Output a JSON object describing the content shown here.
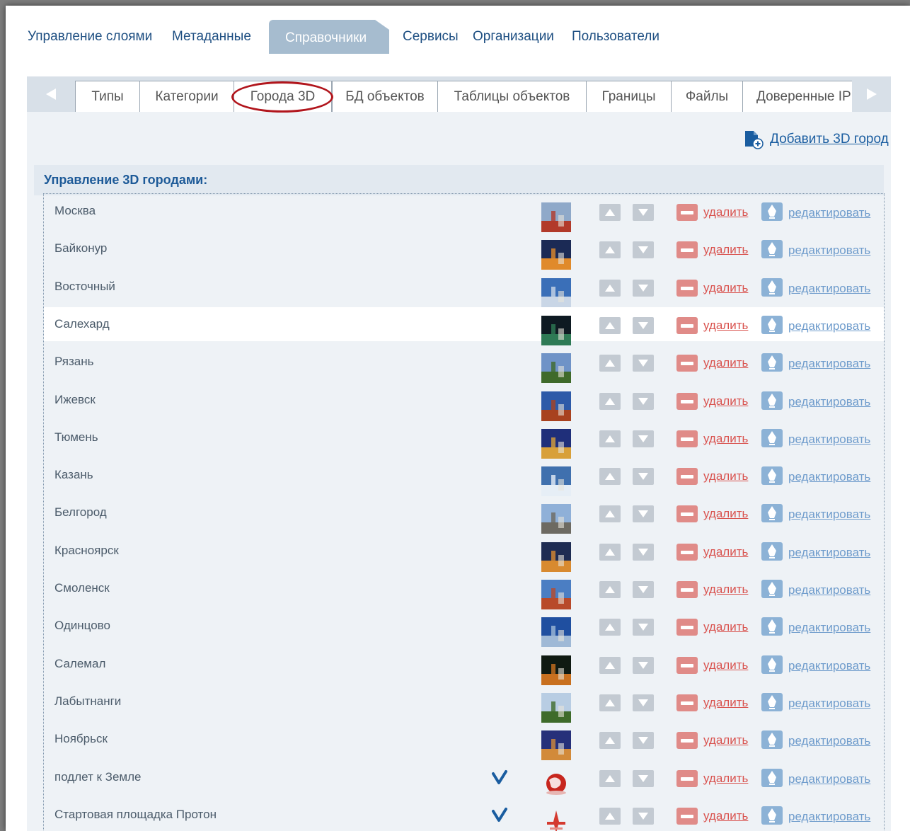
{
  "topnav": {
    "items": [
      "Управление слоями",
      "Метаданные",
      "Справочники",
      "Сервисы",
      "Организации",
      "Пользователи"
    ],
    "active": "Справочники"
  },
  "tabs": {
    "items": [
      "Типы",
      "Категории",
      "Города 3D",
      "БД объектов",
      "Таблицы объектов",
      "Границы",
      "Файлы",
      "Доверенные IP"
    ],
    "active": "Города 3D"
  },
  "add_city_label": "Добавить 3D город",
  "section_title": "Управление 3D городами:",
  "row_actions": {
    "delete_label": "удалить",
    "edit_label": "редактировать"
  },
  "cities": [
    {
      "name": "Москва",
      "checked": false,
      "highlighted": false,
      "thumb": "moscow-photo"
    },
    {
      "name": "Байконур",
      "checked": false,
      "highlighted": false,
      "thumb": "baikonur-photo"
    },
    {
      "name": "Восточный",
      "checked": false,
      "highlighted": false,
      "thumb": "vostochny-photo"
    },
    {
      "name": "Салехард",
      "checked": false,
      "highlighted": true,
      "thumb": "salekhard-photo"
    },
    {
      "name": "Рязань",
      "checked": false,
      "highlighted": false,
      "thumb": "ryazan-photo"
    },
    {
      "name": "Ижевск",
      "checked": false,
      "highlighted": false,
      "thumb": "izhevsk-photo"
    },
    {
      "name": "Тюмень",
      "checked": false,
      "highlighted": false,
      "thumb": "tyumen-photo"
    },
    {
      "name": "Казань",
      "checked": false,
      "highlighted": false,
      "thumb": "kazan-photo"
    },
    {
      "name": "Белгород",
      "checked": false,
      "highlighted": false,
      "thumb": "belgorod-photo"
    },
    {
      "name": "Красноярск",
      "checked": false,
      "highlighted": false,
      "thumb": "krasnoyarsk-photo"
    },
    {
      "name": "Смоленск",
      "checked": false,
      "highlighted": false,
      "thumb": "smolensk-photo"
    },
    {
      "name": "Одинцово",
      "checked": false,
      "highlighted": false,
      "thumb": "odintsovo-photo"
    },
    {
      "name": "Салемал",
      "checked": false,
      "highlighted": false,
      "thumb": "salemal-photo"
    },
    {
      "name": "Лабытнанги",
      "checked": false,
      "highlighted": false,
      "thumb": "labytnangi-photo"
    },
    {
      "name": "Ноябрьск",
      "checked": false,
      "highlighted": false,
      "thumb": "noyabrsk-photo"
    },
    {
      "name": "подлет к Земле",
      "checked": true,
      "highlighted": false,
      "thumb": "earth-icon"
    },
    {
      "name": "Стартовая площадка Протон",
      "checked": true,
      "highlighted": false,
      "thumb": "rocket-icon"
    }
  ],
  "colors": {
    "accent": "#1d5a98",
    "active_tab": "#a6bccf",
    "delete": "#d9534f",
    "edit": "#6f9ccc",
    "circle_highlight": "#b1151c"
  }
}
